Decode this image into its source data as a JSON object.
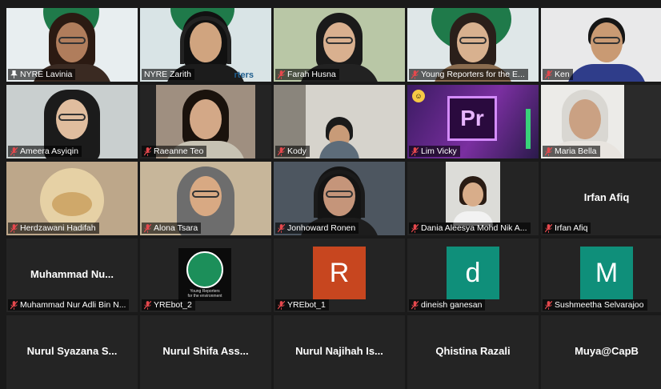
{
  "participants": [
    {
      "name": "NYRE Lavinia",
      "pinned": true,
      "muted": false,
      "speaking": true
    },
    {
      "name": "NYRE Zarith",
      "pinned": false,
      "muted": false
    },
    {
      "name": "Farah Husna",
      "muted": true
    },
    {
      "name": "Young Reporters for the E...",
      "muted": true
    },
    {
      "name": "Ken",
      "muted": true
    },
    {
      "name": "Ameera Asyiqin",
      "muted": true
    },
    {
      "name": "Raeanne Teo",
      "muted": true
    },
    {
      "name": "Kody",
      "muted": true
    },
    {
      "name": "Lim Vicky",
      "muted": true
    },
    {
      "name": "Maria Bella",
      "muted": true
    },
    {
      "name": "Herdzawani Hadifah",
      "muted": true
    },
    {
      "name": "Alona Tsara",
      "muted": true
    },
    {
      "name": "Jonhoward Ronen",
      "muted": true
    },
    {
      "name": "Dania Aleesya Mohd Nik A...",
      "muted": true
    },
    {
      "name": "Irfan Afiq",
      "display": "Irfan Afiq",
      "muted": true
    },
    {
      "name": "Muhammad Nur Adli Bin N...",
      "display": "Muhammad Nu...",
      "muted": true
    },
    {
      "name": "YREbot_2",
      "muted": true
    },
    {
      "name": "YREbot_1",
      "avatar_letter": "R",
      "avatar_color": "#c7461f",
      "muted": true
    },
    {
      "name": "dineish ganesan",
      "avatar_letter": "d",
      "avatar_color": "#0f8f7a",
      "muted": true
    },
    {
      "name": "Sushmeetha Selvarajoo",
      "avatar_letter": "M",
      "avatar_color": "#0f8f7a",
      "muted": true
    },
    {
      "display": "Nurul Syazana S..."
    },
    {
      "display": "Nurul Shifa Ass..."
    },
    {
      "display": "Nurul Najihah Is..."
    },
    {
      "display": "Qhistina Razali"
    },
    {
      "display": "Muya@CapB"
    }
  ],
  "logo_text": {
    "line1": "Young Reporters",
    "line2": "for the environment"
  },
  "banner_text": "rters",
  "app_icon_text": "Pr",
  "colors": {
    "active_speaker": "#c8e23a",
    "muted_mic": "#e5484d",
    "tile_bg": "#242424"
  }
}
